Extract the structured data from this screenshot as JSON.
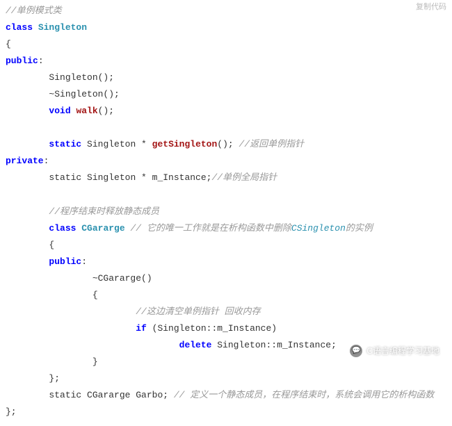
{
  "top_right": "复制代码",
  "lines": {
    "c1": "//单例模式类",
    "kw_class": "class",
    "cls_singleton": "Singleton",
    "brace_open": "{",
    "kw_public": "public",
    "ctor": "Singleton();",
    "dtor": "~Singleton();",
    "kw_void": "void",
    "fn_walk": "walk",
    "walk_paren": "();",
    "kw_static": "static",
    "ret_type": "Singleton * ",
    "fn_getSingleton": "getSingleton",
    "getSingleton_suffix": "(); ",
    "c_getSingleton": "//返回单例指针",
    "kw_private": "private",
    "m_instance_decl": "static Singleton * m_Instance;",
    "c_instance": "//单例全局指针",
    "c_release": "//程序结束时释放静态成员",
    "cls_garbage": "CGararge",
    "c_garbage_pre": " // 它的唯一工作就是在析构函数中删除",
    "c_garbage_type": "CSingleton",
    "c_garbage_post": "的实例",
    "g_dtor": "~CGararge()",
    "c_clear": "//这边清空单例指针 回收内存",
    "kw_if": "if",
    "if_cond": " (Singleton::m_Instance)",
    "kw_delete": "delete",
    "delete_expr": " Singleton::m_Instance;",
    "brace_close": "}",
    "brace_close_semi": "};",
    "garbo_decl_pre": "static CGararge Garbo; ",
    "c_garbo": "// 定义一个静态成员，在程序结束时，系统会调用它的析构函数"
  },
  "watermark": {
    "text": "C语言编程学习基地",
    "icon": "💬"
  }
}
